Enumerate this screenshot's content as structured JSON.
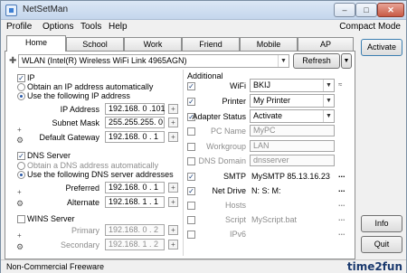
{
  "window": {
    "title": "NetSetMan"
  },
  "menu": {
    "items": [
      "Profile",
      "Options",
      "Tools",
      "Help"
    ],
    "compact_mode": "Compact Mode"
  },
  "tabs": [
    "Home",
    "School",
    "Work",
    "Friend",
    "Mobile",
    "AP"
  ],
  "adapter": {
    "value": "WLAN (Intel(R) Wireless WiFi Link 4965AGN)",
    "refresh": "Refresh"
  },
  "ip": {
    "section": "IP",
    "auto": "Obtain an IP address automatically",
    "manual": "Use the following IP address",
    "address_label": "IP Address",
    "address": "192.168. 0 .101",
    "mask_label": "Subnet Mask",
    "mask": "255.255.255. 0",
    "gateway_label": "Default Gateway",
    "gateway": "192.168. 0 . 1"
  },
  "dns": {
    "section": "DNS Server",
    "auto": "Obtain a DNS address automatically",
    "manual": "Use the following DNS server addresses",
    "preferred_label": "Preferred",
    "preferred": "192.168. 0 . 1",
    "alternate_label": "Alternate",
    "alternate": "192.168. 1 . 1"
  },
  "wins": {
    "section": "WINS Server",
    "primary_label": "Primary",
    "primary": "192.168. 0 . 2",
    "secondary_label": "Secondary",
    "secondary": "192.168. 1 . 2"
  },
  "additional": {
    "section": "Additional",
    "wifi_label": "WiFi",
    "wifi": "BKIJ",
    "printer_label": "Printer",
    "printer": "My Printer",
    "adapter_status_label": "Adapter Status",
    "adapter_status": "Activate",
    "pc_name_label": "PC Name",
    "pc_name": "MyPC",
    "workgroup_label": "Workgroup",
    "workgroup": "LAN",
    "dns_domain_label": "DNS Domain",
    "dns_domain": "dnsserver",
    "smtp_label": "SMTP",
    "smtp": "MySMTP 85.13.16.23",
    "net_drive_label": "Net Drive",
    "net_drive": "N: S: M:",
    "hosts_label": "Hosts",
    "script_label": "Script",
    "script": "MyScript.bat",
    "ipv6_label": "IPv6"
  },
  "buttons": {
    "activate": "Activate",
    "info": "Info",
    "quit": "Quit"
  },
  "status": {
    "text": "Non-Commercial Freeware"
  },
  "watermark": "time2fun"
}
